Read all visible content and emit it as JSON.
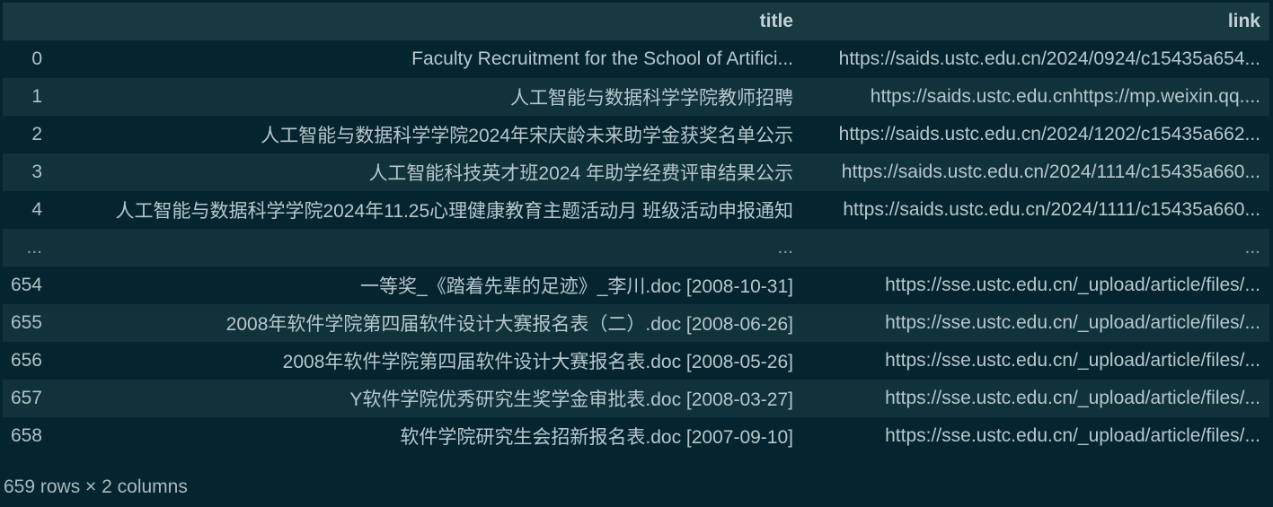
{
  "table": {
    "columns": [
      "",
      "title",
      "link"
    ],
    "rows": [
      {
        "index": "0",
        "title": "Faculty Recruitment for the School of Artifici...",
        "link": "https://saids.ustc.edu.cn/2024/0924/c15435a654..."
      },
      {
        "index": "1",
        "title": "人工智能与数据科学学院教师招聘",
        "link": "https://saids.ustc.edu.cnhttps://mp.weixin.qq...."
      },
      {
        "index": "2",
        "title": "人工智能与数据科学学院2024年宋庆龄未来助学金获奖名单公示",
        "link": "https://saids.ustc.edu.cn/2024/1202/c15435a662..."
      },
      {
        "index": "3",
        "title": "人工智能科技英才班2024 年助学经费评审结果公示",
        "link": "https://saids.ustc.edu.cn/2024/1114/c15435a660..."
      },
      {
        "index": "4",
        "title": "人工智能与数据科学学院2024年11.25心理健康教育主题活动月 班级活动申报通知",
        "link": "https://saids.ustc.edu.cn/2024/1111/c15435a660..."
      },
      {
        "index": "...",
        "title": "...",
        "link": "..."
      },
      {
        "index": "654",
        "title": "一等奖_《踏着先辈的足迹》_李川.doc [2008-10-31]",
        "link": "https://sse.ustc.edu.cn/_upload/article/files/..."
      },
      {
        "index": "655",
        "title": "2008年软件学院第四届软件设计大赛报名表（二）.doc [2008-06-26]",
        "link": "https://sse.ustc.edu.cn/_upload/article/files/..."
      },
      {
        "index": "656",
        "title": "2008年软件学院第四届软件设计大赛报名表.doc [2008-05-26]",
        "link": "https://sse.ustc.edu.cn/_upload/article/files/..."
      },
      {
        "index": "657",
        "title": "Y软件学院优秀研究生奖学金审批表.doc [2008-03-27]",
        "link": "https://sse.ustc.edu.cn/_upload/article/files/..."
      },
      {
        "index": "658",
        "title": "软件学院研究生会招新报名表.doc [2007-09-10]",
        "link": "https://sse.ustc.edu.cn/_upload/article/files/..."
      }
    ]
  },
  "footer": "659 rows × 2 columns",
  "colors": {
    "background": "#04252f",
    "header_row": "#173a42",
    "striped_row": "#0f323b",
    "text": "#b9c6cb"
  }
}
